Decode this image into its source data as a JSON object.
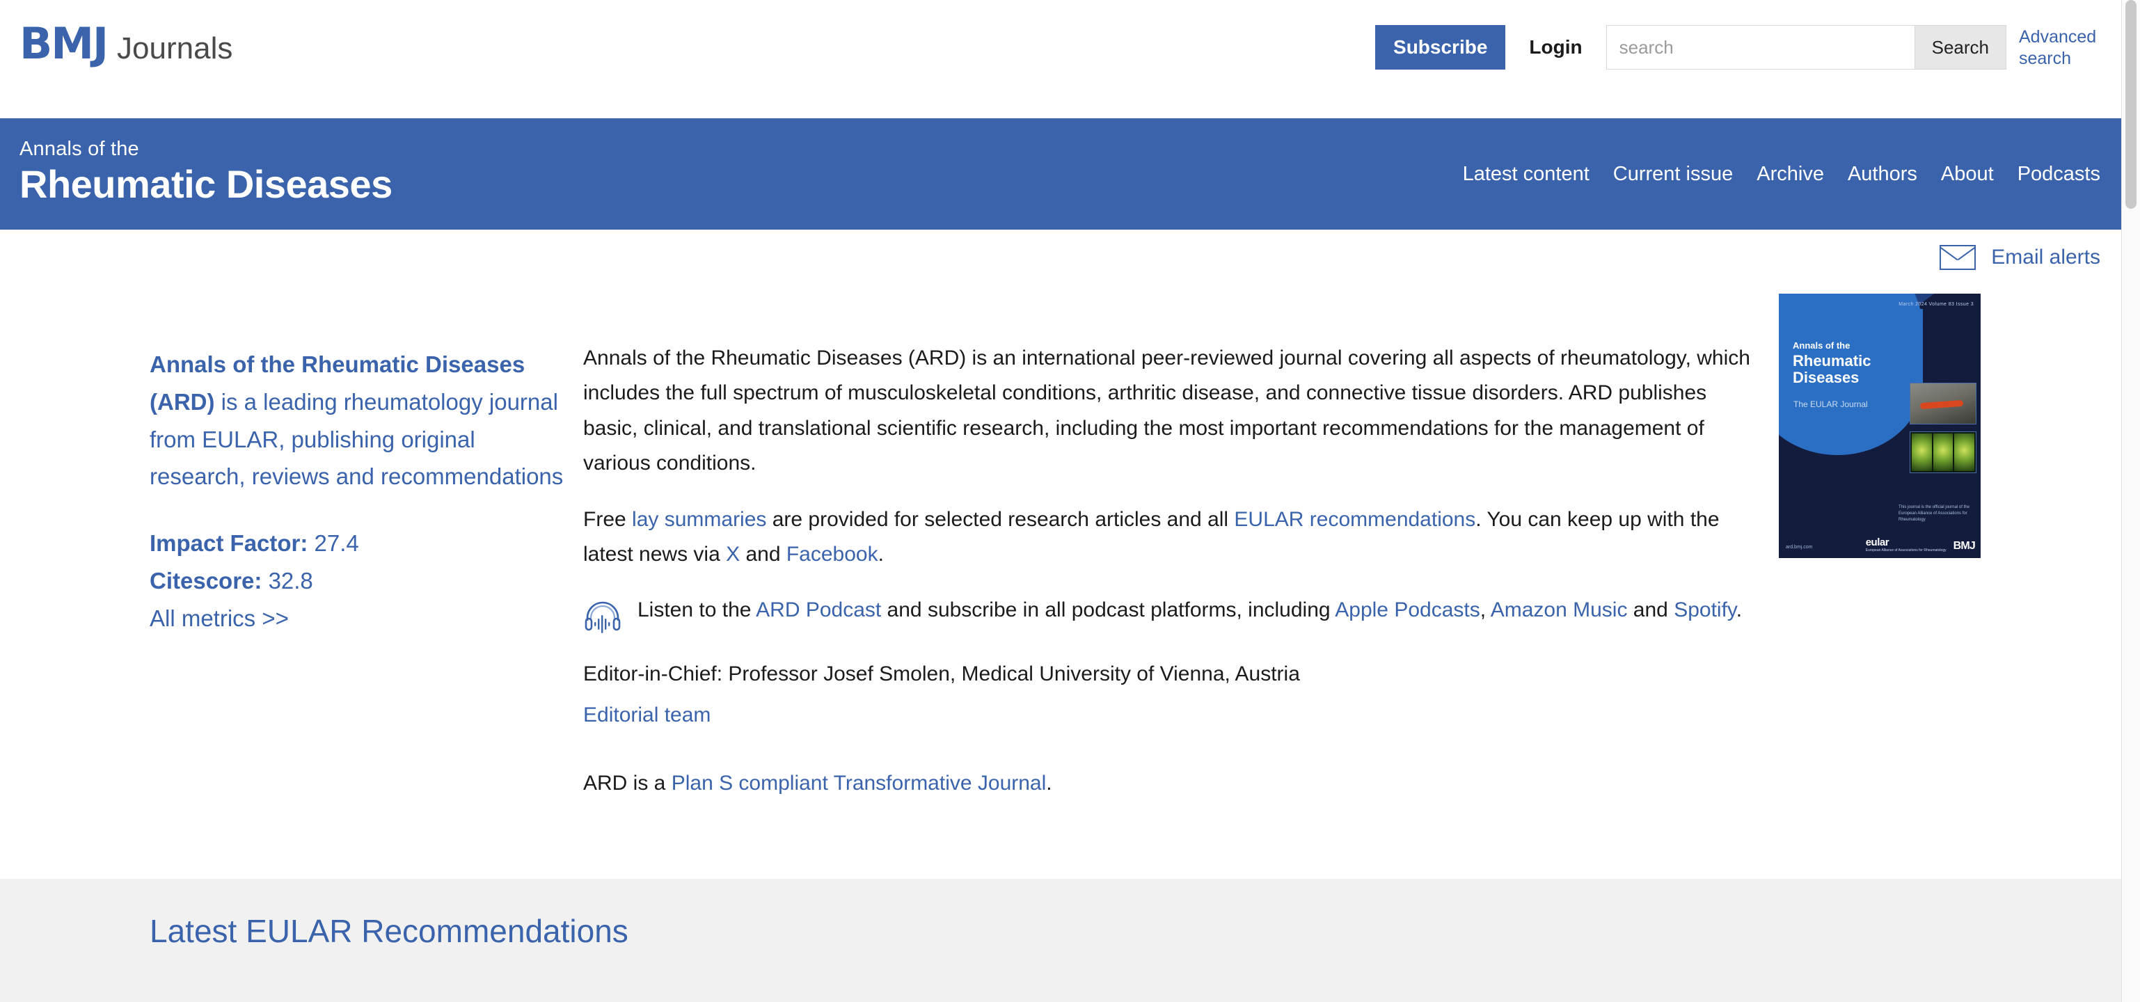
{
  "header": {
    "logo_bmj": "BMJ",
    "logo_journals": "Journals",
    "subscribe_label": "Subscribe",
    "login_label": "Login",
    "search_placeholder": "search",
    "search_value": "",
    "search_button_label": "Search",
    "advanced_search_label": "Advanced search"
  },
  "journal": {
    "kicker": "Annals of the",
    "name": "Rheumatic Diseases",
    "nav": [
      {
        "label": "Latest content"
      },
      {
        "label": "Current issue"
      },
      {
        "label": "Archive"
      },
      {
        "label": "Authors"
      },
      {
        "label": "About"
      },
      {
        "label": "Podcasts"
      }
    ]
  },
  "alerts": {
    "label": "Email alerts",
    "icon": "envelope-icon"
  },
  "left_column": {
    "blurb_bold": "Annals of the Rheumatic Diseases (ARD)",
    "blurb_rest": " is a leading rheumatology journal from EULAR, publishing original research, reviews and recommendations",
    "impact_factor_label": "Impact Factor:",
    "impact_factor_value": "27.4",
    "citescore_label": "Citescore:",
    "citescore_value": "32.8",
    "all_metrics_label": "All metrics >>"
  },
  "body": {
    "para1": "Annals of the Rheumatic Diseases (ARD) is an international peer-reviewed journal covering all aspects of rheumatology, which includes the full spectrum of musculoskeletal conditions, arthritic disease, and connective tissue disorders. ARD publishes basic, clinical, and translational scientific research, including the most important recommendations for the management of various conditions.",
    "para2": {
      "t1": "Free ",
      "link1": "lay summaries",
      "t2": " are provided for selected research articles and all ",
      "link2": "EULAR recommendations",
      "t3": ". You can keep up with the latest news via ",
      "link3": "X",
      "t4": " and ",
      "link4": "Facebook",
      "t5": "."
    },
    "podcast": {
      "icon": "headphones-podcast-icon",
      "t1": "Listen to the ",
      "link1": "ARD Podcast",
      "t2": " and subscribe in all podcast platforms, including ",
      "link2": "Apple Podcasts",
      "t3": ", ",
      "link3": "Amazon Music",
      "t4": " and ",
      "link4": "Spotify",
      "t5": "."
    },
    "editor_line": "Editor-in-Chief: Professor Josef Smolen, Medical University of Vienna, Austria",
    "editorial_team_link": "Editorial team",
    "plan_s": {
      "t1": "ARD is a ",
      "link": "Plan S compliant Transformative Journal",
      "t2": "."
    }
  },
  "cover": {
    "issue_line": "March 2024 Volume 83 Issue 3",
    "title_line1": "Annals",
    "title_line1_small": " of the",
    "title_line2": "Rheumatic",
    "title_line3": "Diseases",
    "subtitle": "The EULAR Journal",
    "credit": "This journal is the official journal of the European Alliance of Associations for Rheumatology",
    "eular_logo": "eular",
    "eular_sub": "European Alliance of Associations for Rheumatology",
    "bmj_logo": "BMJ",
    "site": "ard.bmj.com"
  },
  "grey_section": {
    "title": "Latest EULAR Recommendations"
  },
  "colors": {
    "brand_blue": "#3A63AC",
    "link_blue": "#3A63AC",
    "grey_bg": "#F1F1F1",
    "body_text": "#1B1B1B"
  }
}
